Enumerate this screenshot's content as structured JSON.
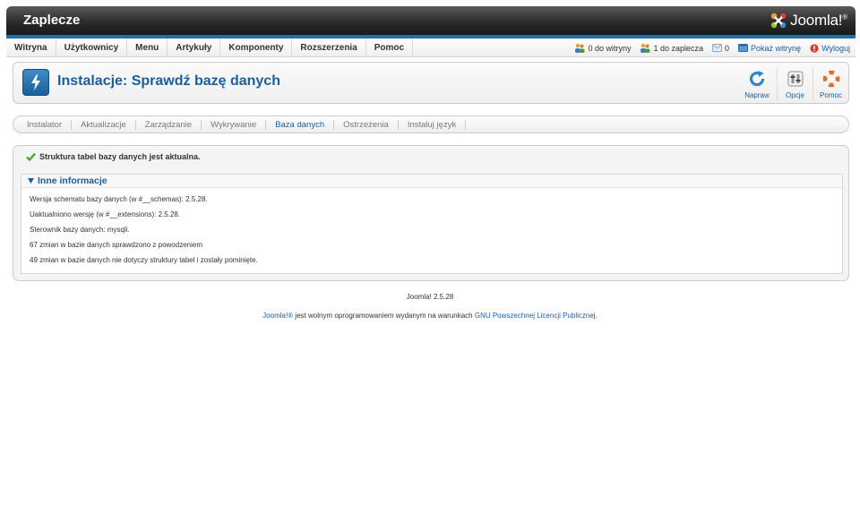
{
  "header": {
    "title": "Zaplecze",
    "logo_text": "Joomla!",
    "logo_mark": "®"
  },
  "menu": {
    "items": [
      "Witryna",
      "Użytkownicy",
      "Menu",
      "Artykuły",
      "Komponenty",
      "Rozszerzenia",
      "Pomoc"
    ]
  },
  "status": {
    "site_visitors": "0 do witryny",
    "admin_visitors": "1 do zaplecza",
    "messages": "0",
    "view_site": "Pokaż witrynę",
    "logout": "Wyloguj"
  },
  "page": {
    "title": "Instalacje: Sprawdź bazę danych"
  },
  "toolbar": {
    "fix": "Napraw",
    "options": "Opcje",
    "help": "Pomoc"
  },
  "submenu": {
    "items": [
      "Instalator",
      "Aktualizacje",
      "Zarządzanie",
      "Wykrywanie",
      "Baza danych",
      "Ostrzeżenia",
      "Instaluj język"
    ],
    "active": "Baza danych"
  },
  "message": "Struktura tabel bazy danych jest aktualna.",
  "panel": {
    "title": "Inne informacje",
    "lines": [
      "Wersja schematu bazy danych (w #__schemas): 2.5.28.",
      "Uaktualniono wersję (w #__extensions): 2.5.28.",
      "Sterownik bazy danych: mysqli.",
      "67 zmian w bazie danych sprawdzono z powodzeniem",
      "49 zmian w bazie danych nie dotyczy struktury tabel i zostały pominięte."
    ]
  },
  "footer": {
    "version": "Joomla! 2.5.28",
    "joomla_link": "Joomla!®",
    "license_text": " jest wolnym oprogramowaniem wydanym na warunkach ",
    "license_link": "GNU Powszechnej Licencji Publicznej",
    "license_end": "."
  },
  "colors": {
    "accent": "#1d5d9b",
    "header_dark": "#2b2b2b",
    "blue_bar": "#1f6fa8"
  }
}
